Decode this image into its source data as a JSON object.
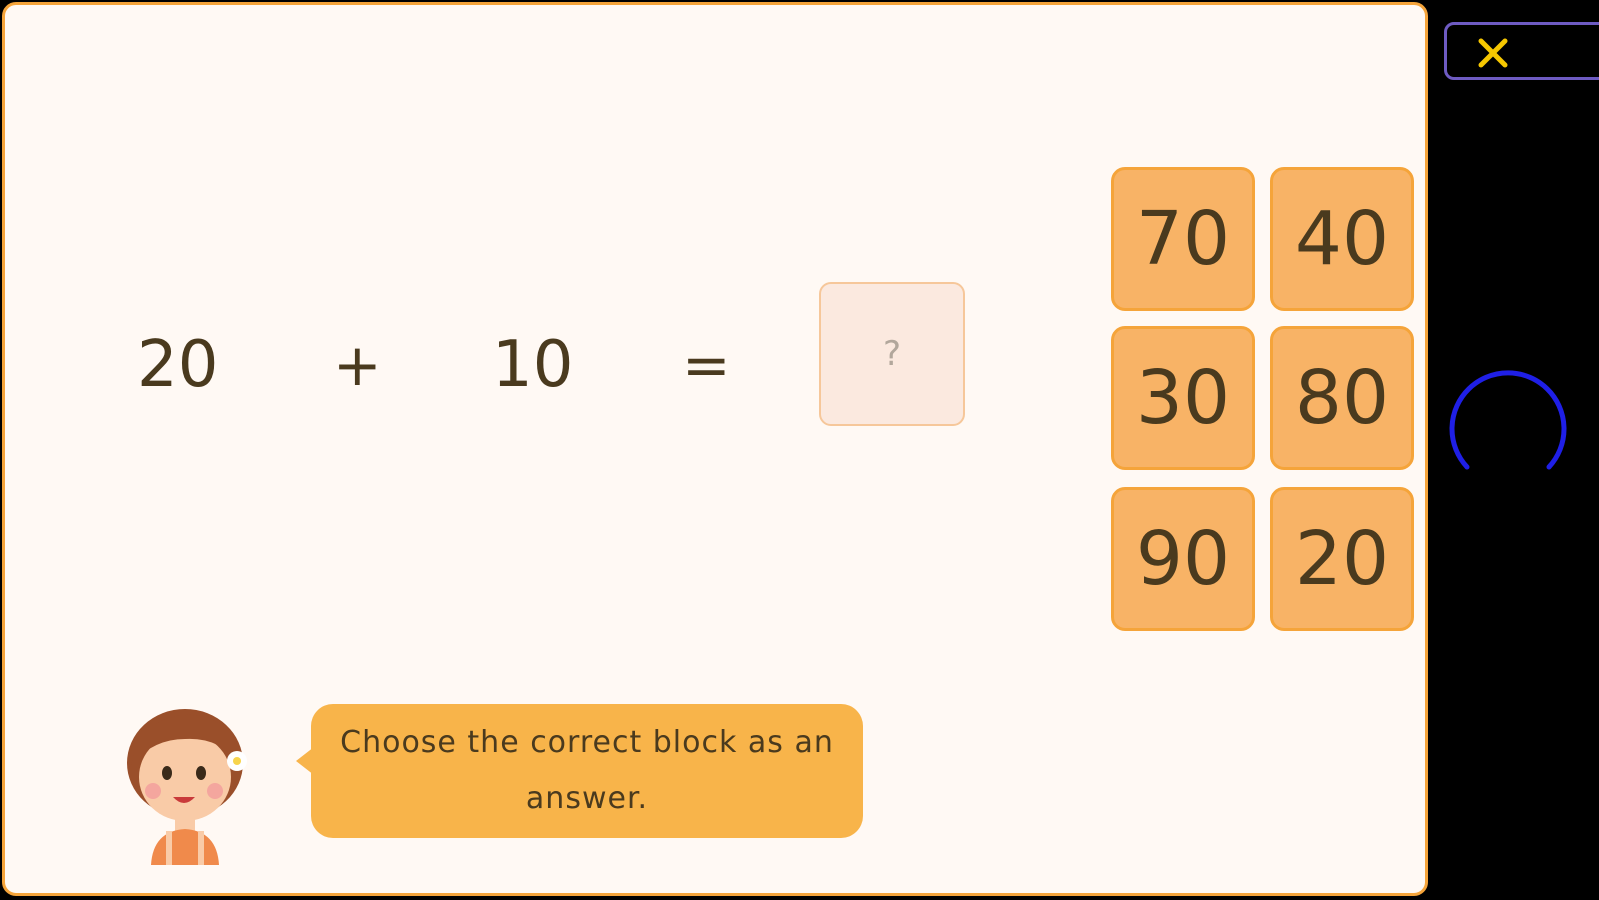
{
  "equation": {
    "operand1": "20",
    "operator": "+",
    "operand2": "10",
    "equals": "=",
    "answer_placeholder": "?"
  },
  "choices": [
    "70",
    "40",
    "30",
    "80",
    "90",
    "20"
  ],
  "instruction": {
    "text": "Choose the correct block as an answer."
  },
  "colors": {
    "accent": "#F5A43A",
    "block_fill": "#F8B366",
    "bubble_fill": "#F8B44A",
    "text": "#4A3A1E",
    "close_icon": "#F6C700",
    "close_border": "#6E5BC2",
    "loader": "#1F1FE6"
  },
  "icons": {
    "close": "close-icon",
    "loader": "loading-spinner-icon",
    "character": "girl-character-avatar"
  }
}
